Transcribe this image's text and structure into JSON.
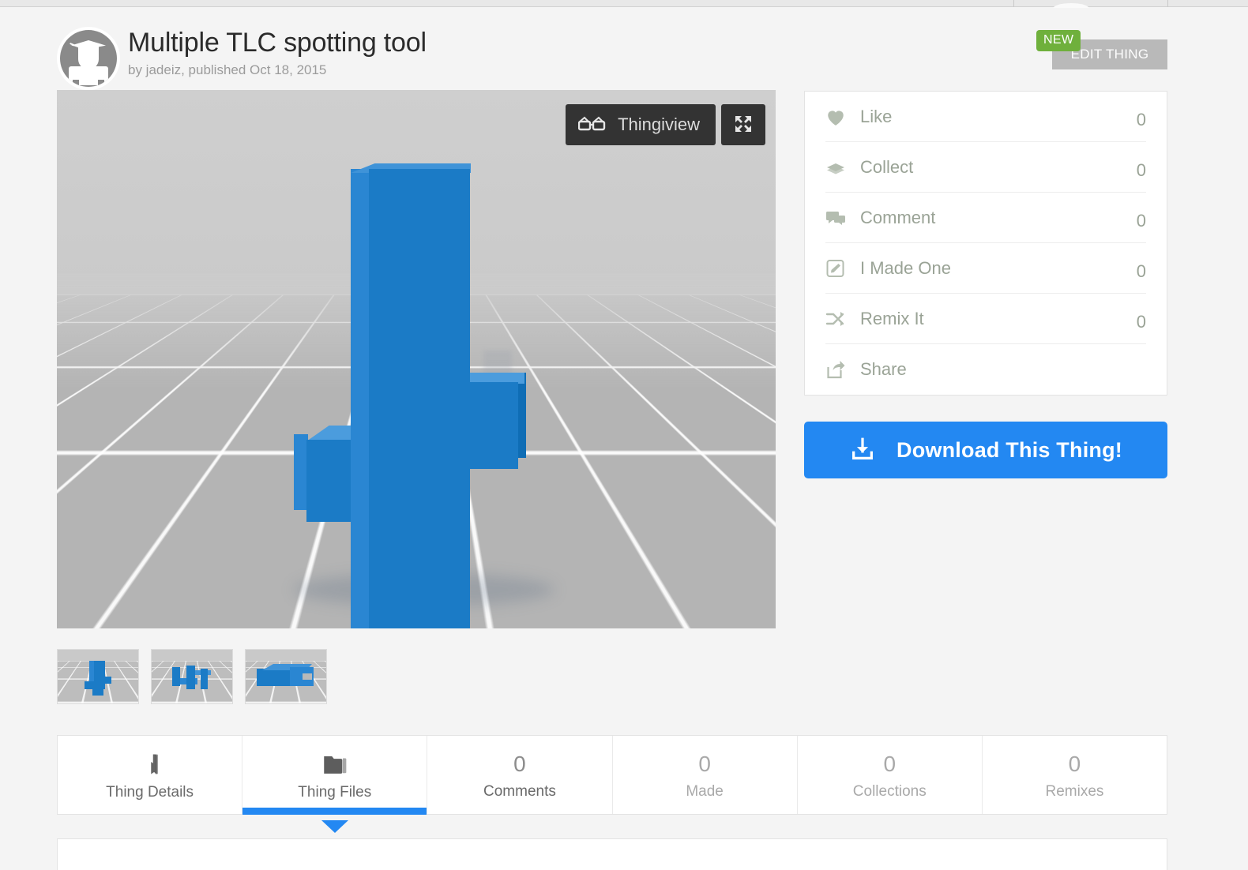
{
  "browser": {
    "tab_divider_positions": [
      1283,
      1478
    ]
  },
  "header": {
    "title": "Multiple TLC spotting tool",
    "byline": "by jadeiz, published Oct 18, 2015",
    "avatar_name": "thingiverse-user-avatar",
    "new_badge": "NEW",
    "edit_button": "EDIT THING"
  },
  "viewer": {
    "thingiview_label": "Thingiview",
    "glasses_icon": "3d-glasses-icon",
    "fullscreen_icon": "fullscreen-expand-icon",
    "background_color": "#c9c9c9",
    "model_color": "#1b7bc6"
  },
  "thumbnails": [
    {
      "name": "thumbnail-1"
    },
    {
      "name": "thumbnail-2"
    },
    {
      "name": "thumbnail-3"
    }
  ],
  "actions": [
    {
      "icon": "heart-icon",
      "label": "Like",
      "count": "0"
    },
    {
      "icon": "books-icon",
      "label": "Collect",
      "count": "0"
    },
    {
      "icon": "comment-icon",
      "label": "Comment",
      "count": "0"
    },
    {
      "icon": "pencil-square-icon",
      "label": "I Made One",
      "count": "0"
    },
    {
      "icon": "shuffle-icon",
      "label": "Remix It",
      "count": "0"
    },
    {
      "icon": "share-icon",
      "label": "Share",
      "count": ""
    }
  ],
  "download": {
    "label": "Download This Thing!",
    "icon": "download-icon",
    "color": "#2388f2"
  },
  "tabs": [
    {
      "icon": "book-bookmark-icon",
      "num": "",
      "label": "Thing Details",
      "active": false,
      "dim": false
    },
    {
      "icon": "folder-icon",
      "num": "",
      "label": "Thing Files",
      "active": true,
      "dim": false
    },
    {
      "icon": "",
      "num": "0",
      "label": "Comments",
      "active": false,
      "dim": false
    },
    {
      "icon": "",
      "num": "0",
      "label": "Made",
      "active": false,
      "dim": true
    },
    {
      "icon": "",
      "num": "0",
      "label": "Collections",
      "active": false,
      "dim": true
    },
    {
      "icon": "",
      "num": "0",
      "label": "Remixes",
      "active": false,
      "dim": true
    }
  ],
  "colors": {
    "accent_blue": "#2388f2",
    "badge_green": "#6fb03c",
    "page_bg": "#f4f4f4",
    "muted_text": "#9aa396"
  }
}
